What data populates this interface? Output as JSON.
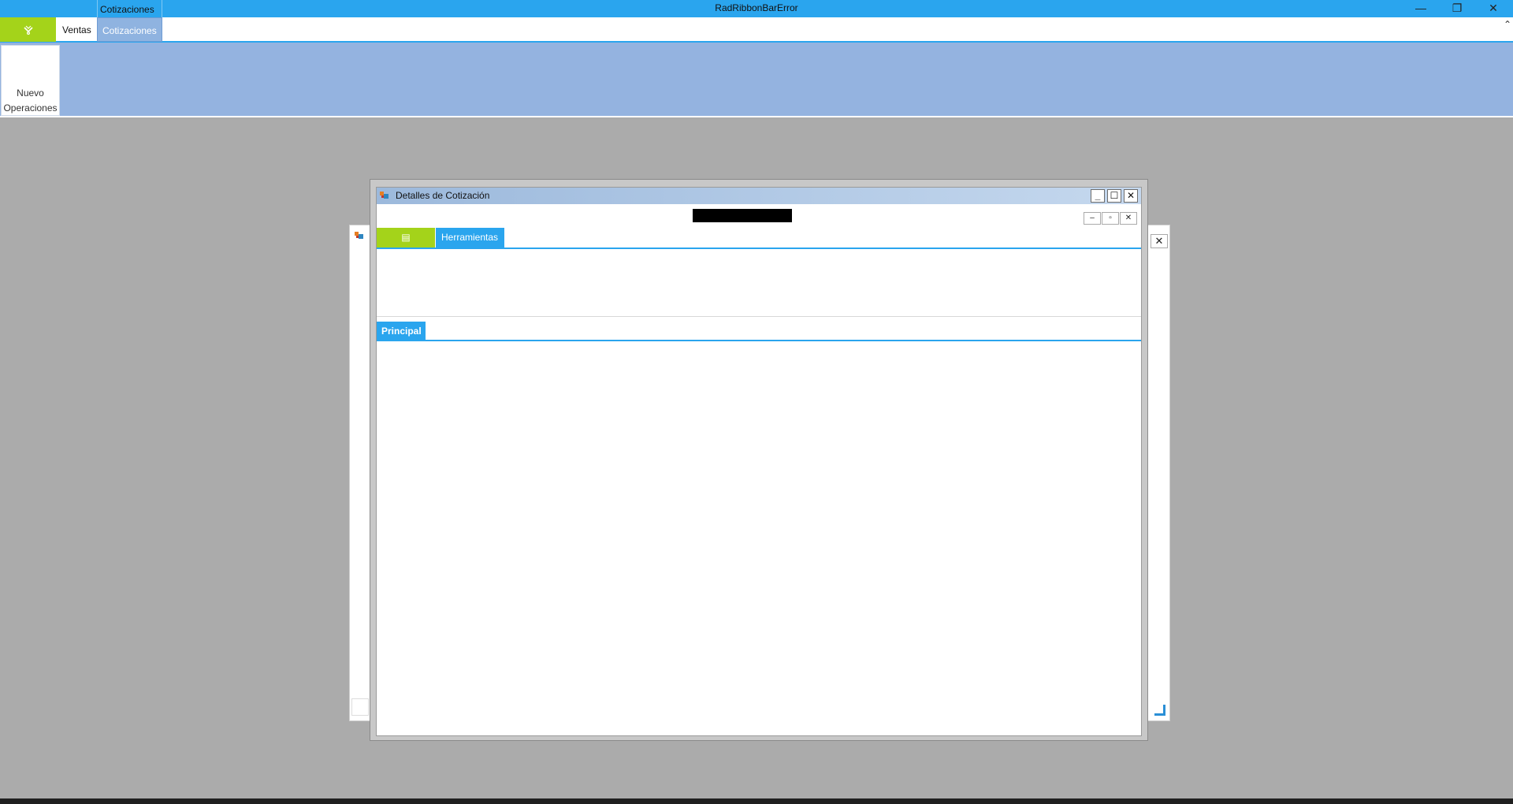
{
  "window": {
    "title": "RadRibbonBarError",
    "context_tab_header": "Cotizaciones",
    "minimize_glyph": "—",
    "restore_glyph": "❐",
    "close_glyph": "✕"
  },
  "ribbon": {
    "app_button_icon": "app-menu-icon",
    "tabs": [
      {
        "label": "Ventas"
      },
      {
        "label": "Cotizaciones",
        "selected": true
      }
    ],
    "collapse_glyph": "⌃",
    "buttons": [
      {
        "label_line1": "Nuevo",
        "label_line2": "Operaciones"
      }
    ]
  },
  "background_window": {
    "close_glyph": "✕"
  },
  "dialog": {
    "title": "Detalles de Cotización",
    "minimize_glyph": "_",
    "maximize_glyph": "☐",
    "close_glyph": "✕",
    "mdi_minimize_glyph": "–",
    "mdi_restore_glyph": "▫",
    "mdi_close_glyph": "✕",
    "inner_ribbon": {
      "app_button_glyph": "▤",
      "tabs": [
        {
          "label": "Herramientas"
        }
      ]
    },
    "page_view": {
      "tabs": [
        {
          "label": "Principal"
        }
      ]
    }
  },
  "colors": {
    "accent": "#2aa5ee",
    "app_button": "#a4d31a",
    "ribbon_panel": "#94b3e0",
    "workspace": "#ababab"
  }
}
